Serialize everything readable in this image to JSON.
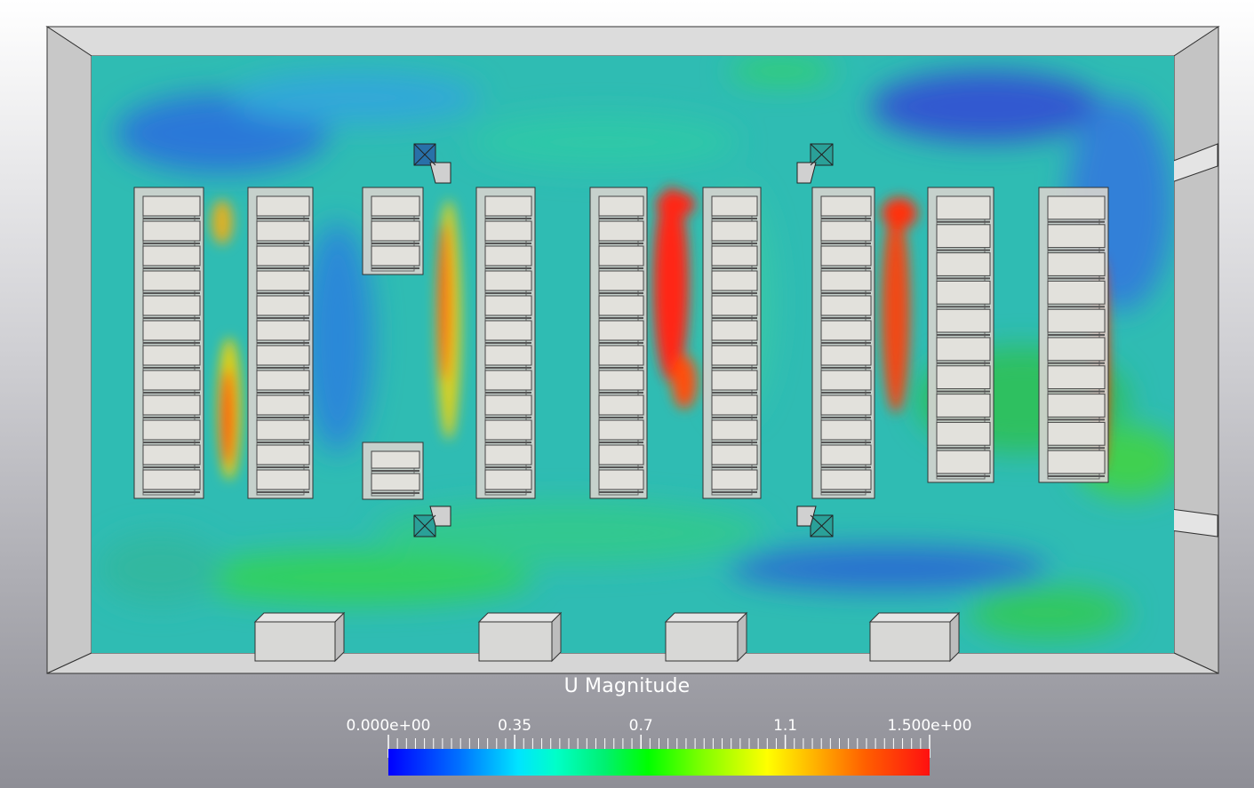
{
  "legend": {
    "title": "U Magnitude",
    "min_label": "0.000e+00",
    "max_label": "1.500e+00",
    "labels": [
      {
        "text": "0.000e+00",
        "value": 0.0
      },
      {
        "text": "0.35",
        "value": 0.35
      },
      {
        "text": "0.7",
        "value": 0.7
      },
      {
        "text": "1.1",
        "value": 1.1
      },
      {
        "text": "1.500e+00",
        "value": 1.5
      }
    ],
    "range": [
      0,
      1.5
    ],
    "colormap": [
      "#0000ff",
      "#00e4ff",
      "#00ff00",
      "#ffff00",
      "#ff1010"
    ]
  },
  "colors": {
    "wall": "#cfcfcf",
    "rack": "#d4d3ce",
    "field_base": "#2ec0b5"
  }
}
